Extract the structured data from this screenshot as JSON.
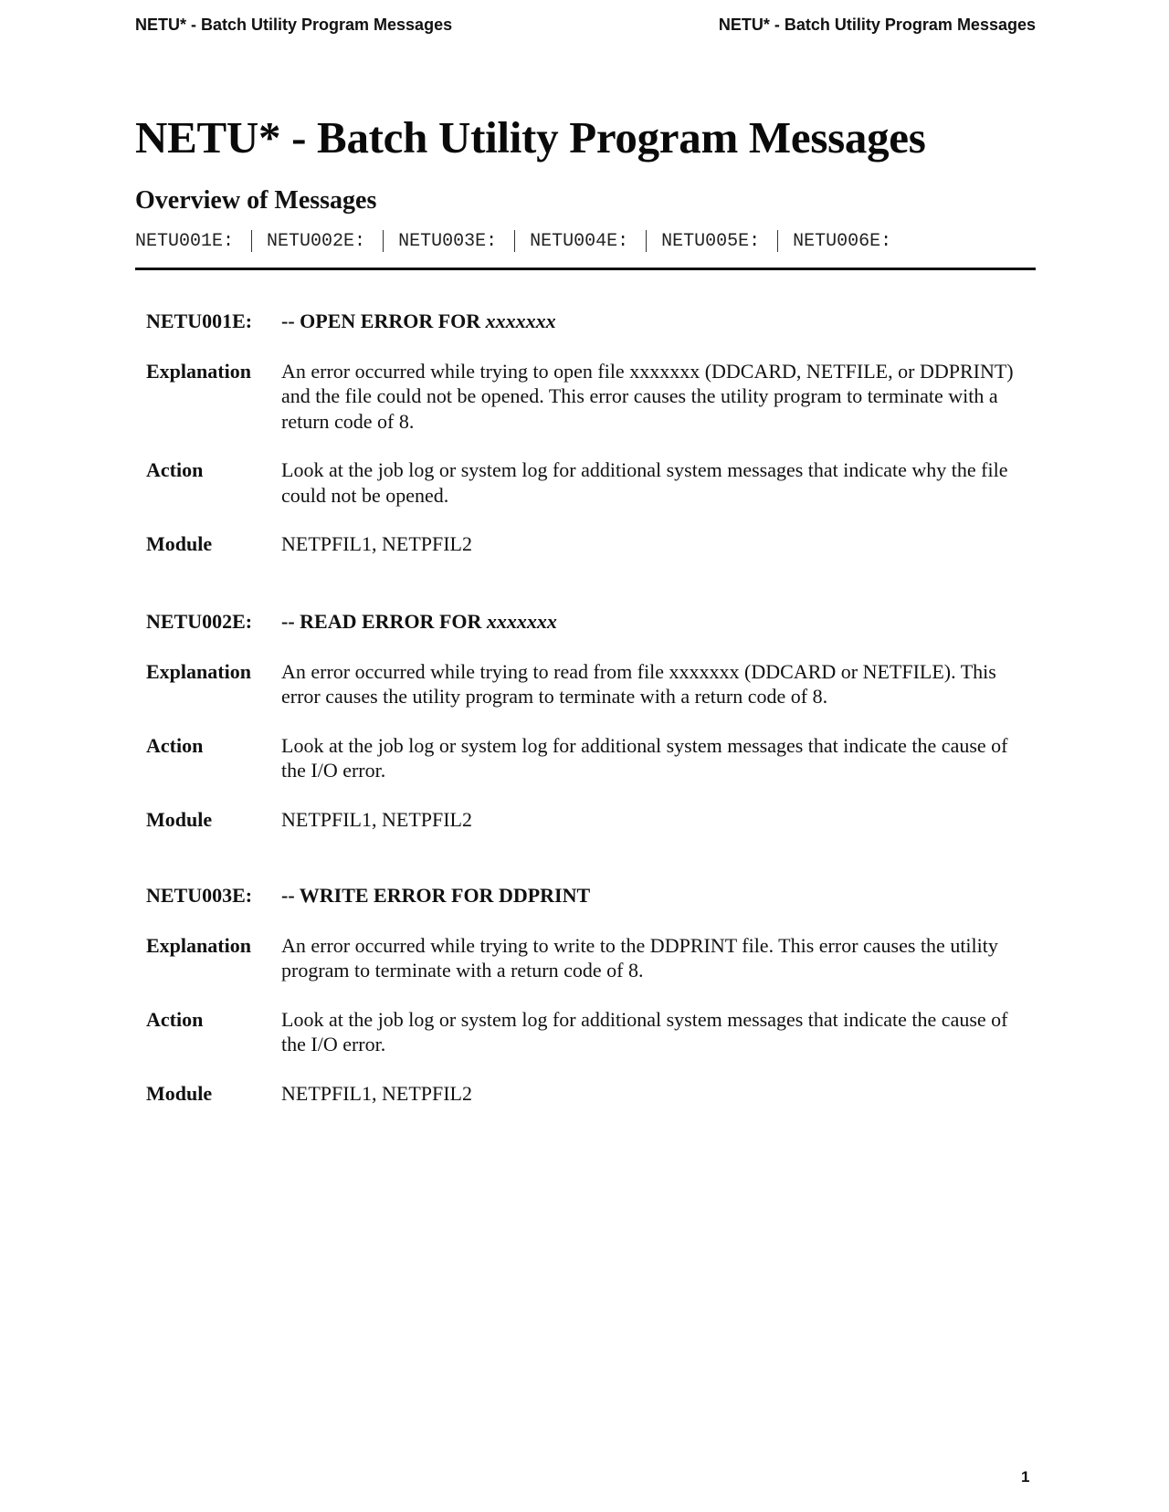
{
  "running_header": {
    "left": "NETU* - Batch Utility Program Messages",
    "right": "NETU* - Batch Utility Program Messages"
  },
  "title": "NETU* - Batch Utility Program Messages",
  "overview": {
    "heading": "Overview of Messages",
    "links": [
      "NETU001E:",
      "NETU002E:",
      "NETU003E:",
      "NETU004E:",
      "NETU005E:",
      "NETU006E:"
    ]
  },
  "labels": {
    "explanation": "Explanation",
    "action": "Action",
    "module": "Module"
  },
  "messages": [
    {
      "code": "NETU001E:",
      "text": "-- OPEN ERROR FOR ",
      "param": "xxxxxxx",
      "explanation": "An error occurred while trying to open file xxxxxxx (DDCARD, NETFILE, or DDPRINT) and the file could not be opened. This error causes the utility program to terminate with a return code of 8.",
      "action": "Look at the job log or system log for additional system messages that indicate why the file could not be opened.",
      "module": "NETPFIL1, NETPFIL2"
    },
    {
      "code": "NETU002E:",
      "text": "-- READ ERROR FOR ",
      "param": "xxxxxxx",
      "explanation": "An error occurred while trying to read from file xxxxxxx (DDCARD or NETFILE). This error causes the utility program to terminate with a return code of 8.",
      "action": "Look at the job log or system log for additional system messages that indicate the cause of the I/O error.",
      "module": "NETPFIL1, NETPFIL2"
    },
    {
      "code": "NETU003E:",
      "text": "-- WRITE ERROR FOR DDPRINT",
      "param": "",
      "explanation": "An error occurred while trying to write to the DDPRINT file. This error causes the utility program to terminate with a return code of 8.",
      "action": "Look at the job log or system log for additional system messages that indicate the cause of the I/O error.",
      "module": "NETPFIL1, NETPFIL2"
    }
  ],
  "page_number": "1"
}
